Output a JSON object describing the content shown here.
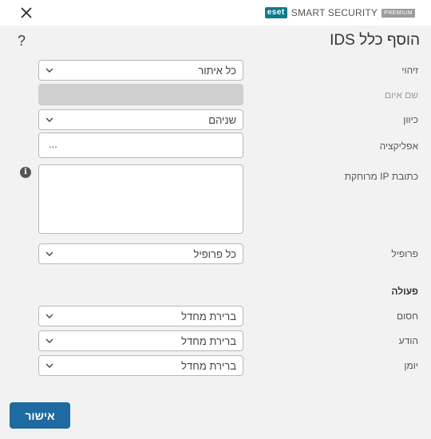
{
  "titlebar": {
    "brand_logo": "eset",
    "brand_name": "SMART SECURITY",
    "brand_edition": "PREMIUM",
    "close_icon": "close-icon"
  },
  "header": {
    "help": "?",
    "title": "הוסף כלל IDS"
  },
  "form": {
    "detection": {
      "label": "זיהוי",
      "value": "כל איתור"
    },
    "threat_name": {
      "label": "שם איום",
      "value": ""
    },
    "direction": {
      "label": "כיוון",
      "value": "שניהם"
    },
    "application": {
      "label": "אפליקציה",
      "value": "..."
    },
    "remote_ip": {
      "label": "כתובת IP מרוחקת",
      "value": "",
      "info_icon": "i"
    },
    "profile": {
      "label": "פרופיל",
      "value": "כל פרופיל"
    }
  },
  "action": {
    "heading": "פעולה",
    "block": {
      "label": "חסום",
      "value": "ברירת מחדל"
    },
    "notify": {
      "label": "הודע",
      "value": "ברירת מחדל"
    },
    "log": {
      "label": "יומן",
      "value": "ברירת מחדל"
    }
  },
  "footer": {
    "ok_label": "אישור"
  },
  "colors": {
    "background": "#f2f2f2",
    "primary_button": "#1f6aa0",
    "eset_brand": "#0f7a8c",
    "disabled_field": "#cfcfcf"
  }
}
